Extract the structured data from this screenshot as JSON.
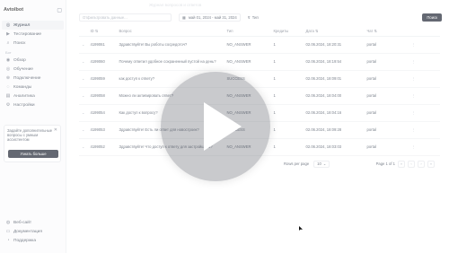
{
  "brand": {
    "name": "Avtolbot"
  },
  "sidebar": {
    "items": [
      {
        "label": "Журнал",
        "icon": "journal-icon",
        "active": true
      },
      {
        "label": "Тестирование",
        "icon": "test-icon"
      },
      {
        "label": "Поиск",
        "icon": "search-icon"
      }
    ],
    "section_label": "Бот",
    "bot_items": [
      {
        "label": "Обзор",
        "icon": "overview-icon"
      },
      {
        "label": "Обучение",
        "icon": "learning-icon"
      },
      {
        "label": "Подключение",
        "icon": "connect-icon"
      },
      {
        "label": "Команды",
        "icon": "commands-icon"
      },
      {
        "label": "Аналитика",
        "icon": "analytics-icon"
      },
      {
        "label": "Настройки",
        "icon": "settings-icon"
      }
    ],
    "promo": {
      "text": "Задайте дополнительные вопросы с умным ассистентом",
      "button": "Узнать больше"
    },
    "bottom_items": [
      {
        "label": "Веб-сайт",
        "icon": "globe-icon"
      },
      {
        "label": "Документация",
        "icon": "doc-icon"
      },
      {
        "label": "Поддержка",
        "icon": "support-icon"
      }
    ]
  },
  "toolbar": {
    "faint_title": "Журнал вопросов и ответов",
    "search_placeholder": "Отфильтровать данные...",
    "date_range": "май 01, 2024 - май 31, 2024",
    "filter_label": "Тип",
    "reset_label": "Поиск"
  },
  "table": {
    "columns": [
      "ID",
      "Вопрос",
      "Тип",
      "Кредиты",
      "Дата",
      "Чат"
    ],
    "rows": [
      {
        "id": "4199061",
        "question": "Здравствуйте! Вы роботы сосредоточ?",
        "type": "NO_ANSWER",
        "credits": "1",
        "date": "02.06.2024, 18:20:31",
        "chat": "portal"
      },
      {
        "id": "4199060",
        "question": "Почему ответил удобное сохраненный пустой на день?",
        "type": "NO_ANSWER",
        "credits": "1",
        "date": "02.06.2024, 18:19:54",
        "chat": "portal"
      },
      {
        "id": "4199059",
        "question": "как доступ к ответу?",
        "type": "SUCCESS",
        "credits": "1",
        "date": "02.06.2024, 18:09:01",
        "chat": "portal"
      },
      {
        "id": "4199058",
        "question": "Можно ли активировать ответ?",
        "type": "NO_ANSWER",
        "credits": "1",
        "date": "02.06.2024, 18:04:00",
        "chat": "portal"
      },
      {
        "id": "4199054",
        "question": "Как доступ к вопросу?",
        "type": "NO_ANSWER",
        "credits": "1",
        "date": "02.06.2024, 18:04:16",
        "chat": "portal"
      },
      {
        "id": "4199053",
        "question": "Здравствуйте! Есть ли ответ для новостроек?",
        "type": "SUCCESS",
        "credits": "1",
        "date": "02.06.2024, 18:09:28",
        "chat": "portal"
      },
      {
        "id": "4199052",
        "question": "Здравствуйте! Что доступ к ответу для застройщика?",
        "type": "NO_ANSWER",
        "credits": "1",
        "date": "02.06.2024, 18:03:03",
        "chat": "portal"
      }
    ]
  },
  "pagination": {
    "rows_label": "Rows per page",
    "rows_value": "10",
    "page_label": "Page 1 of 1"
  }
}
